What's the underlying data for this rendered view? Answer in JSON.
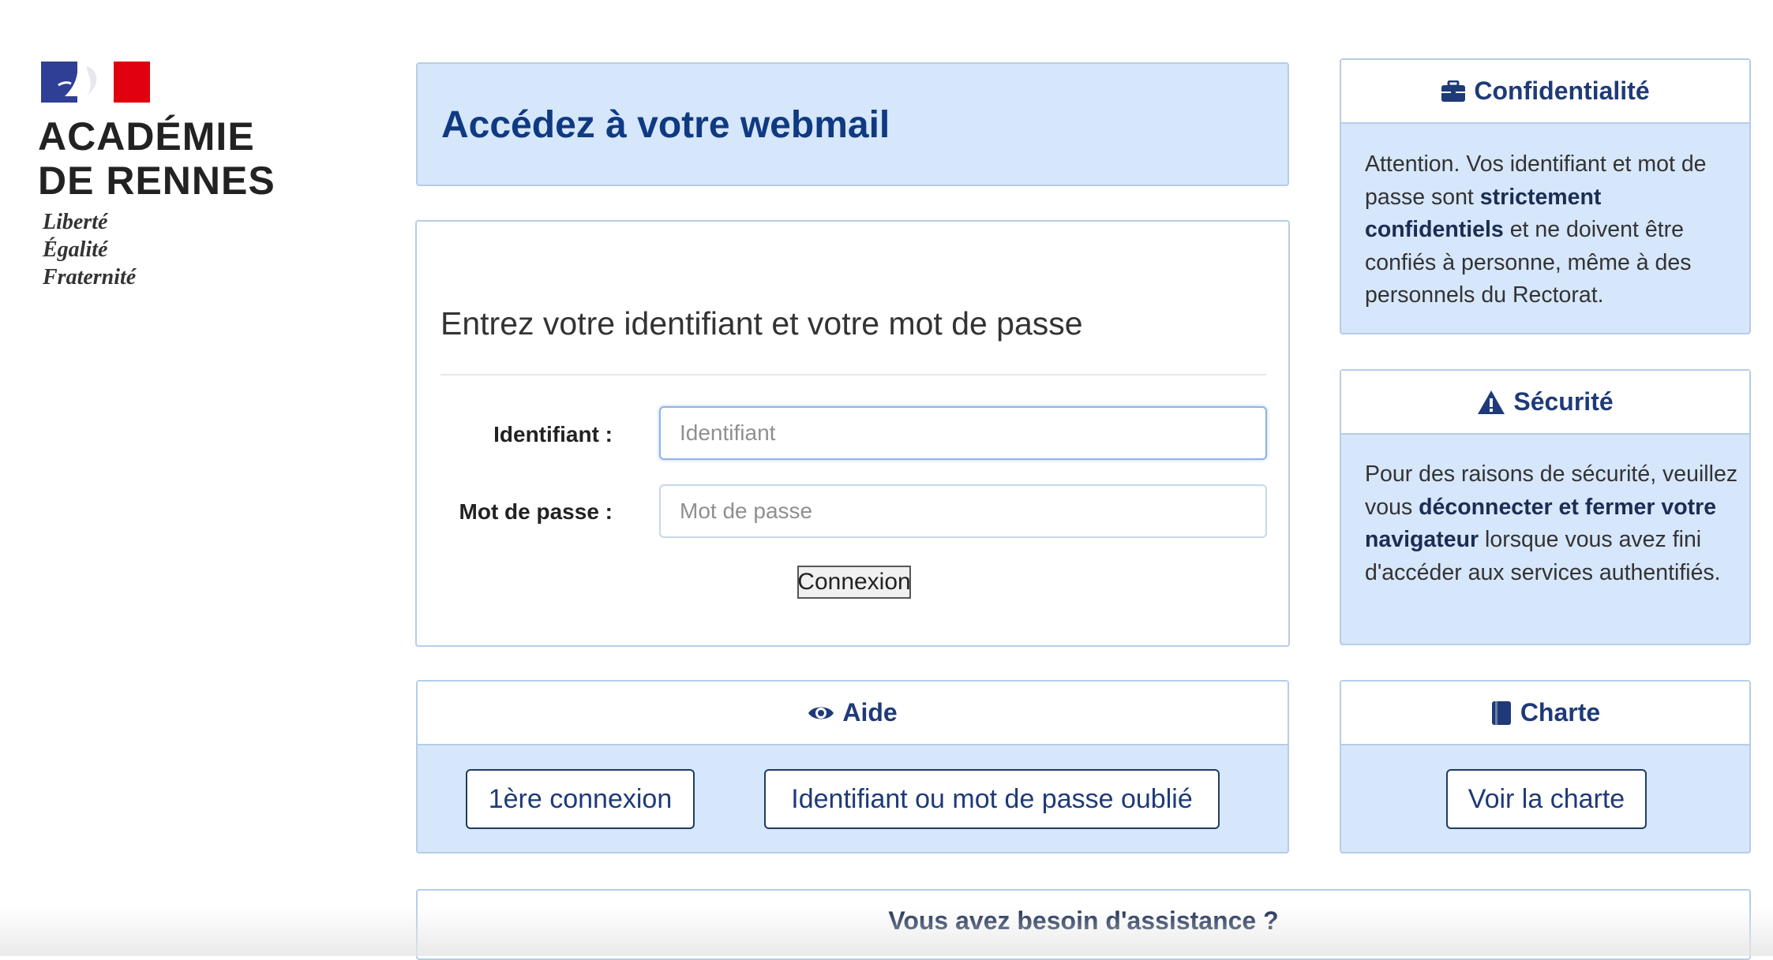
{
  "logo": {
    "name_line1": "ACADÉMIE",
    "name_line2": "DE RENNES",
    "motto": [
      "Liberté",
      "Égalité",
      "Fraternité"
    ],
    "flag_colors": {
      "blue": "#2f3f95",
      "white": "#ffffff",
      "red": "#e1000f"
    }
  },
  "header": {
    "title": "Accédez à votre webmail"
  },
  "login": {
    "title": "Entrez votre identifiant et votre mot de passe",
    "username_label": "Identifiant :",
    "username_placeholder": "Identifiant",
    "password_label": "Mot de passe :",
    "password_placeholder": "Mot de passe",
    "submit_label": "Connexion"
  },
  "confidentiality": {
    "title": "Confidentialité",
    "icon": "briefcase-icon",
    "text_1": "Attention. Vos identifiant et mot de passe sont ",
    "text_bold": "strictement confidentiels",
    "text_2": " et ne doivent être confiés à personne, même à des personnels du Rectorat."
  },
  "security": {
    "title": "Sécurité",
    "icon": "warning-icon",
    "text_1": "Pour des raisons de sécurité, veuillez vous ",
    "text_bold": "déconnecter et fermer votre navigateur",
    "text_2": " lorsque vous avez fini d'accéder aux services authentifiés."
  },
  "help": {
    "title": "Aide",
    "icon": "eye-icon",
    "first_login_label": "1ère connexion",
    "forgot_label": "Identifiant ou mot de passe oublié"
  },
  "charter": {
    "title": "Charte",
    "icon": "book-icon",
    "button_label": "Voir la charte"
  },
  "assistance": {
    "title": "Vous avez besoin d'assistance ?"
  },
  "colors": {
    "accent_dark": "#0f3a82",
    "panel_blue": "#d6e6fb",
    "panel_border": "#b5cde9"
  }
}
